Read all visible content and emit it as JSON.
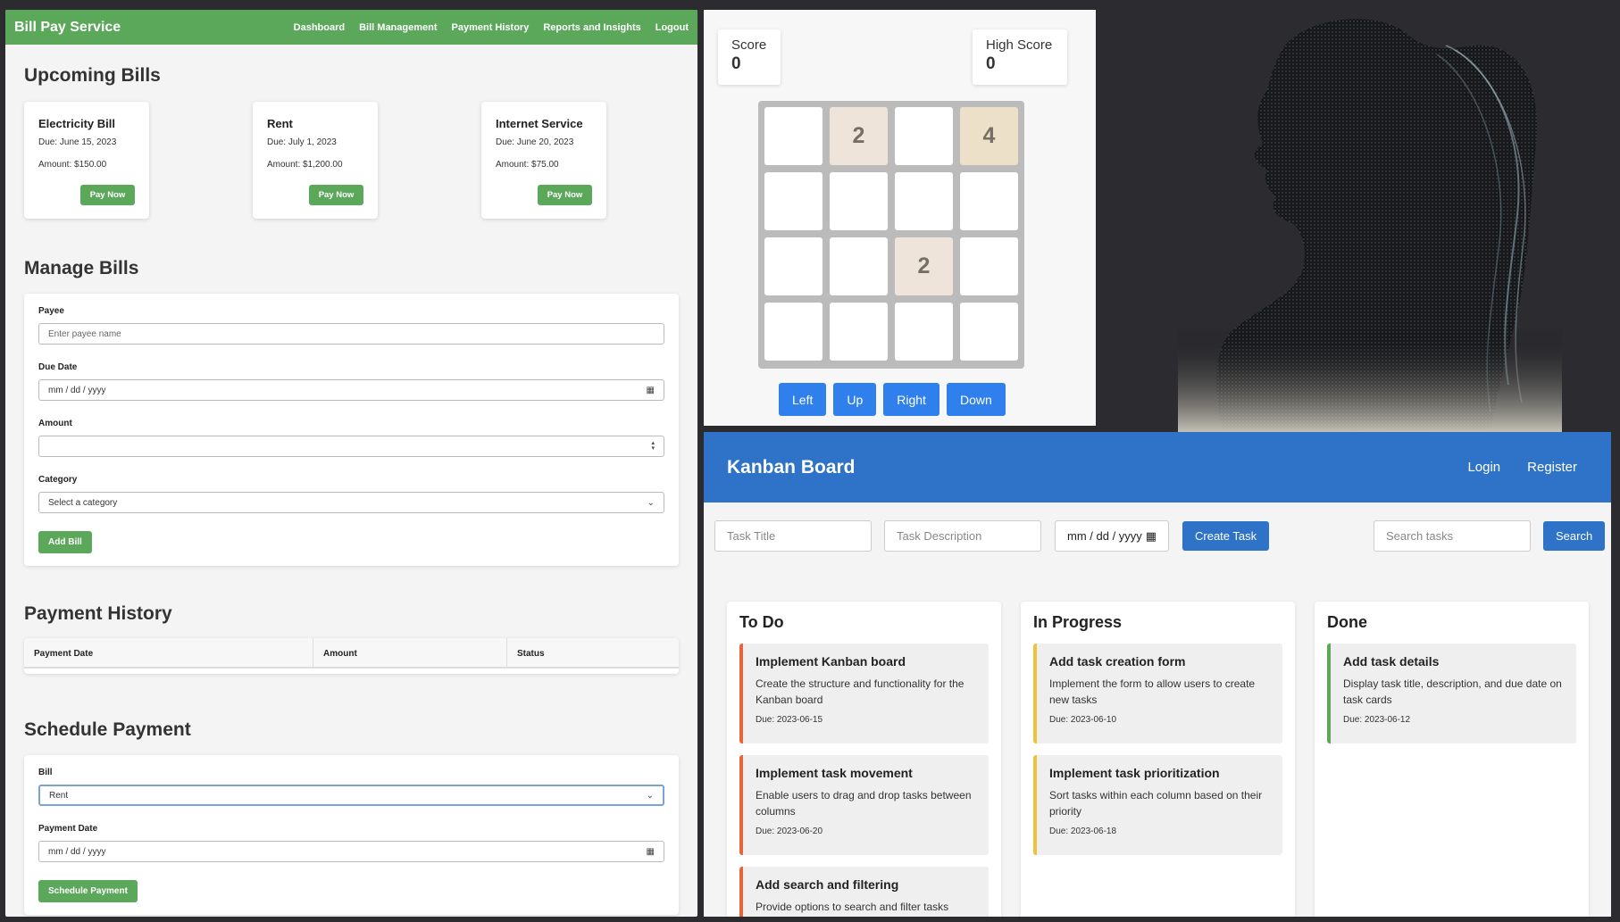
{
  "billpay": {
    "brand": "Bill Pay Service",
    "nav": [
      "Dashboard",
      "Bill Management",
      "Payment History",
      "Reports and Insights",
      "Logout"
    ],
    "upcoming_title": "Upcoming Bills",
    "bills": [
      {
        "name": "Electricity Bill",
        "due": "Due: June 15, 2023",
        "amount": "Amount: $150.00",
        "button": "Pay Now"
      },
      {
        "name": "Rent",
        "due": "Due: July 1, 2023",
        "amount": "Amount: $1,200.00",
        "button": "Pay Now"
      },
      {
        "name": "Internet Service",
        "due": "Due: June 20, 2023",
        "amount": "Amount: $75.00",
        "button": "Pay Now"
      }
    ],
    "manage_title": "Manage Bills",
    "form": {
      "payee_label": "Payee",
      "payee_placeholder": "Enter payee name",
      "due_label": "Due Date",
      "due_placeholder": "mm / dd / yyyy",
      "amount_label": "Amount",
      "category_label": "Category",
      "category_value": "Select a category",
      "add_button": "Add Bill"
    },
    "history_title": "Payment History",
    "history_columns": [
      "Payment Date",
      "Amount",
      "Status"
    ],
    "schedule_title": "Schedule Payment",
    "schedule": {
      "bill_label": "Bill",
      "bill_value": "Rent",
      "date_label": "Payment Date",
      "date_placeholder": "mm / dd / yyyy",
      "button": "Schedule Payment"
    }
  },
  "game": {
    "score_label": "Score",
    "score": "0",
    "high_label": "High Score",
    "high": "0",
    "grid": [
      [
        "",
        "2",
        "",
        "4"
      ],
      [
        "",
        "",
        "",
        ""
      ],
      [
        "",
        "",
        "2",
        ""
      ],
      [
        "",
        "",
        "",
        ""
      ]
    ],
    "buttons": [
      "Left",
      "Up",
      "Right",
      "Down"
    ]
  },
  "kanban": {
    "title": "Kanban Board",
    "login": "Login",
    "register": "Register",
    "title_placeholder": "Task Title",
    "desc_placeholder": "Task Description",
    "date_placeholder": "mm / dd / yyyy",
    "create_button": "Create Task",
    "search_placeholder": "Search tasks",
    "search_button": "Search",
    "columns": [
      {
        "name": "To Do",
        "tasks": [
          {
            "title": "Implement Kanban board",
            "desc": "Create the structure and functionality for the Kanban board",
            "due": "Due: 2023-06-15"
          },
          {
            "title": "Implement task movement",
            "desc": "Enable users to drag and drop tasks between columns",
            "due": "Due: 2023-06-20"
          },
          {
            "title": "Add search and filtering",
            "desc": "Provide options to search and filter tasks",
            "due": ""
          }
        ]
      },
      {
        "name": "In Progress",
        "tasks": [
          {
            "title": "Add task creation form",
            "desc": "Implement the form to allow users to create new tasks",
            "due": "Due: 2023-06-10"
          },
          {
            "title": "Implement task prioritization",
            "desc": "Sort tasks within each column based on their priority",
            "due": "Due: 2023-06-18"
          }
        ]
      },
      {
        "name": "Done",
        "tasks": [
          {
            "title": "Add task details",
            "desc": "Display task title, description, and due date on task cards",
            "due": "Due: 2023-06-12"
          }
        ]
      }
    ]
  },
  "colors": {
    "billpay_green": "#5ba85a",
    "game_blue": "#2f80ed",
    "kanban_blue": "#2e73c7",
    "todo": "#e8643a",
    "progress": "#f0c23c",
    "done": "#5ba85a"
  },
  "icons": [
    "calendar-icon",
    "chevron-down-icon",
    "spinner-arrows-icon"
  ]
}
